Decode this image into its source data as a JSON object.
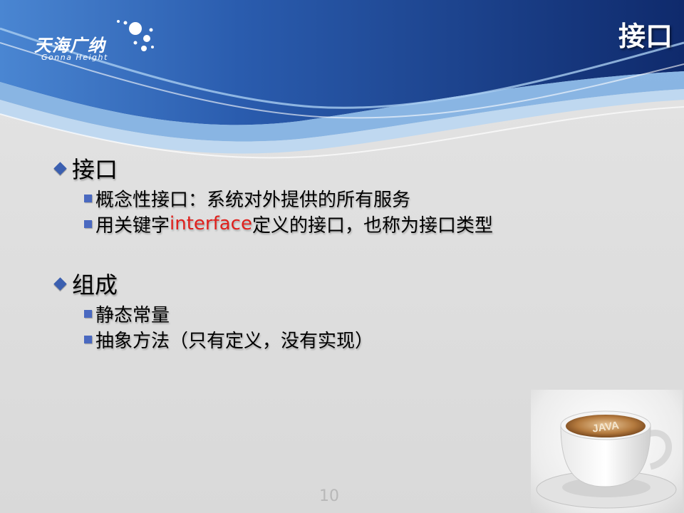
{
  "header": {
    "title": "接口",
    "logo_cn": "天海广纳",
    "logo_en": "Gonna Height",
    "colors": {
      "banner_dark": "#1a3b84",
      "banner_light": "#3f78c8",
      "wave": "#7fb0e3"
    }
  },
  "sections": [
    {
      "heading": "接口",
      "items": [
        {
          "before": "概念性接口：系统对外提供的所有服务",
          "highlight": "",
          "after": ""
        },
        {
          "before": "用关键字",
          "highlight": "interface",
          "after": "定义的接口，也称为接口类型"
        }
      ]
    },
    {
      "heading": "组成",
      "items": [
        {
          "before": "静态常量",
          "highlight": "",
          "after": ""
        },
        {
          "before": "抽象方法（只有定义，没有实现）",
          "highlight": "",
          "after": ""
        }
      ]
    }
  ],
  "image": {
    "cup_text": "JAVA",
    "icon": "java-coffee-cup"
  },
  "footer": {
    "page_number": "10"
  },
  "colors": {
    "highlight": "#e0201c",
    "bullet": "#3b5fb0"
  }
}
